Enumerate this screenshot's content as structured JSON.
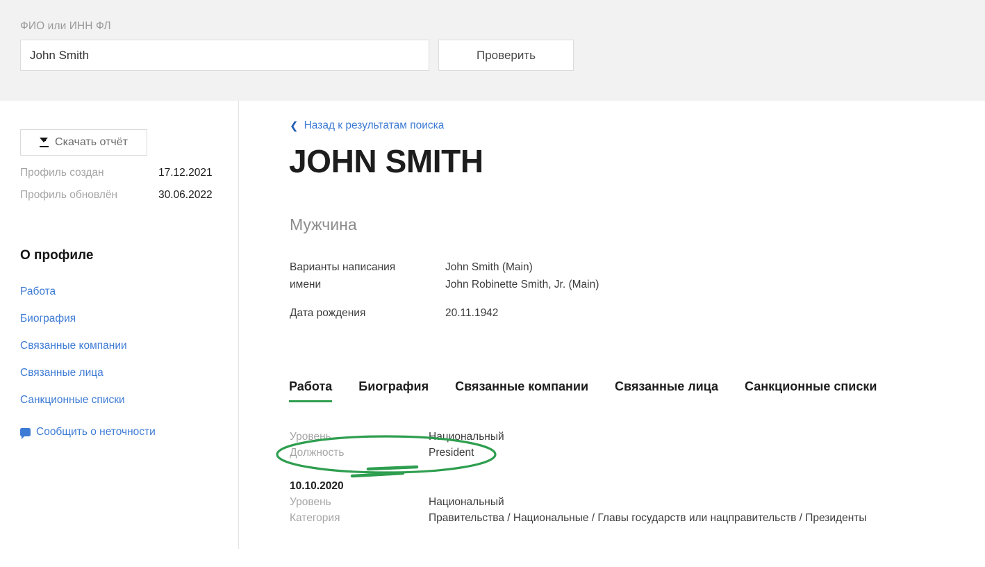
{
  "search": {
    "label": "ФИО или ИНН ФЛ",
    "value": "John Smith",
    "placeholder": "ФИО или ИНН ФЛ",
    "button_label": "Проверить"
  },
  "sidebar": {
    "download_label": "Скачать отчёт",
    "download_icon": "download-icon",
    "meta": [
      {
        "key": "Профиль создан",
        "value": "17.12.2021"
      },
      {
        "key": "Профиль обновлён",
        "value": "30.06.2022"
      }
    ],
    "about_title": "О профиле",
    "nav_items": [
      {
        "label": "Работа"
      },
      {
        "label": "Биография"
      },
      {
        "label": "Связанные компании"
      },
      {
        "label": "Связанные лица"
      },
      {
        "label": "Санкционные списки"
      }
    ],
    "report_link": {
      "label": "Сообщить о неточности",
      "icon": "chat-bubble-icon"
    }
  },
  "main": {
    "back_link": {
      "label": "Назад к результатам поиска",
      "icon": "chevron-left-icon"
    },
    "person_name": "JOHN SMITH",
    "gender": "Мужчина",
    "facts": [
      {
        "key": "Варианты написания имени",
        "values": [
          "John Smith (Main)",
          "John Robinette Smith, Jr. (Main)"
        ]
      },
      {
        "key": "Дата рождения",
        "values": [
          "20.11.1942"
        ]
      }
    ],
    "tabs": [
      {
        "label": "Работа",
        "active": true
      },
      {
        "label": "Биография",
        "active": false
      },
      {
        "label": "Связанные компании",
        "active": false
      },
      {
        "label": "Связанные лица",
        "active": false
      },
      {
        "label": "Санкционные списки",
        "active": false
      }
    ],
    "job": {
      "current": [
        {
          "key": "Уровень",
          "value": "Национальный"
        },
        {
          "key": "Должность",
          "value": "President"
        }
      ],
      "history_date": "10.10.2020",
      "history": [
        {
          "key": "Уровень",
          "value": "Национальный"
        },
        {
          "key": "Категория",
          "value": "Правительства / Национальные / Главы государств или нацправительств / Президенты"
        }
      ]
    }
  },
  "annotation": {
    "shape": "ellipse-highlight",
    "color": "#2e9e4f",
    "target": "Должность — President"
  },
  "colors": {
    "header_bg": "#f2f2f2",
    "link": "#3d7bd4",
    "muted": "#a5a5a5",
    "accent_green": "#2e9e4f",
    "text": "#1d1d1d"
  }
}
